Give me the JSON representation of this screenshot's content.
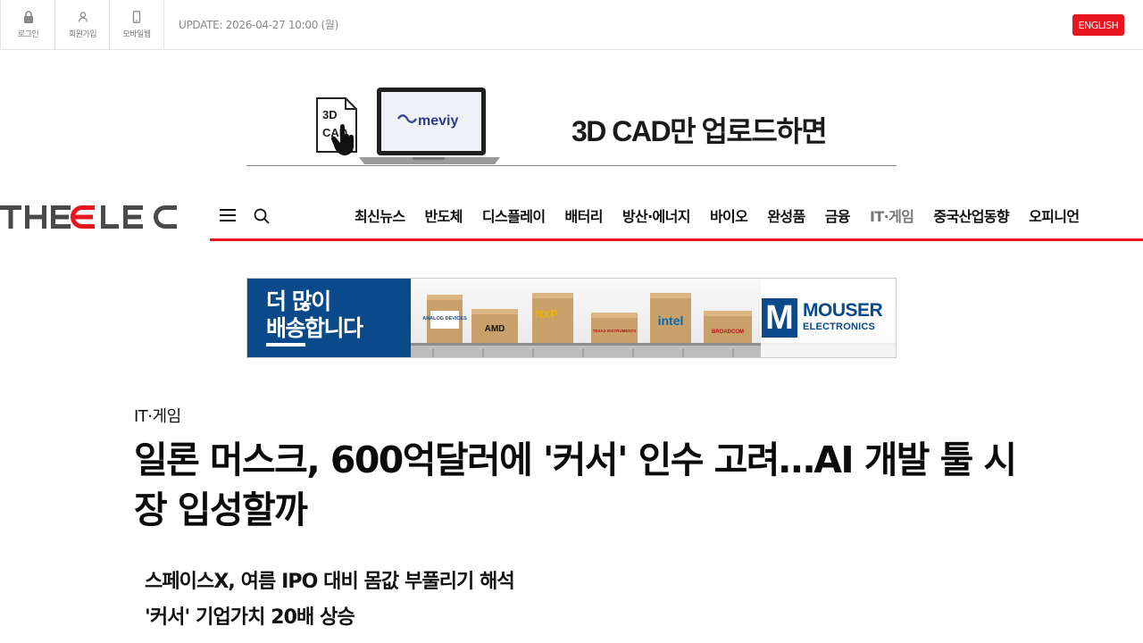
{
  "utility": {
    "login": "로그인",
    "signup": "회원가입",
    "mobile": "모바일웹",
    "update": "UPDATE: 2026-04-27 10:00 (월)",
    "english": "ENGLISH"
  },
  "ad_top": {
    "doc_line1": "3D",
    "doc_line2": "CAD",
    "brand": "meviy",
    "headline": "3D CAD만 업로드하면"
  },
  "header": {
    "logo": "THEELEC",
    "nav": [
      "최신뉴스",
      "반도체",
      "디스플레이",
      "배터리",
      "방산·에너지",
      "바이오",
      "완성품",
      "금융",
      "IT·게임",
      "중국산업동향",
      "오피니언"
    ],
    "active_index": 8
  },
  "ad_mouser": {
    "line1": "더 많이",
    "line2": "배송합니다",
    "boxes": [
      "ANALOG DEVICES",
      "AMD",
      "NXP",
      "TEXAS INSTRUMENTS",
      "intel",
      "BROADCOM"
    ],
    "brand_line1": "MOUSER",
    "brand_line2": "ELECTRONICS"
  },
  "article": {
    "category": "IT·게임",
    "title": "일론 머스크, 600억달러에 '커서' 인수 고려…AI 개발 툴 시장 입성할까",
    "subtitles": [
      "스페이스X, 여름 IPO 대비 몸값 부풀리기 해석",
      "'커서' 기업가치 20배 상승"
    ]
  },
  "colors": {
    "accent_red": "#e8141e",
    "mouser_blue": "#0b4a8a",
    "logo_gray": "#4a4a4a"
  }
}
